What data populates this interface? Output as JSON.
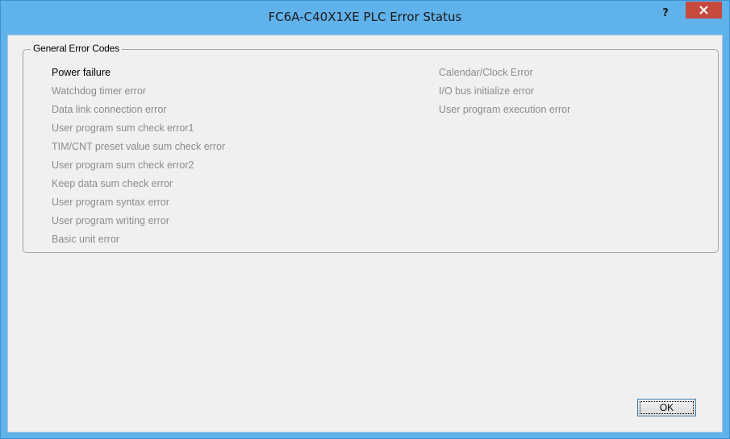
{
  "window": {
    "title": "FC6A-C40X1XE PLC Error Status",
    "help_label": "?",
    "accent_color": "#5fb2ea",
    "close_color": "#c74a3f"
  },
  "group": {
    "label": "General Error Codes",
    "left_column": [
      {
        "label": "Power failure",
        "active": true
      },
      {
        "label": "Watchdog timer error",
        "active": false
      },
      {
        "label": "Data link connection error",
        "active": false
      },
      {
        "label": "User program sum check error1",
        "active": false
      },
      {
        "label": "TIM/CNT preset value sum check error",
        "active": false
      },
      {
        "label": "User program sum check error2",
        "active": false
      },
      {
        "label": "Keep data sum check error",
        "active": false
      },
      {
        "label": "User program syntax error",
        "active": false
      },
      {
        "label": "User program writing error",
        "active": false
      },
      {
        "label": "Basic unit error",
        "active": false
      }
    ],
    "right_column": [
      {
        "label": "Calendar/Clock Error",
        "active": false
      },
      {
        "label": "I/O bus initialize error",
        "active": false
      },
      {
        "label": "User program execution error",
        "active": false
      }
    ]
  },
  "buttons": {
    "ok_label": "OK"
  }
}
